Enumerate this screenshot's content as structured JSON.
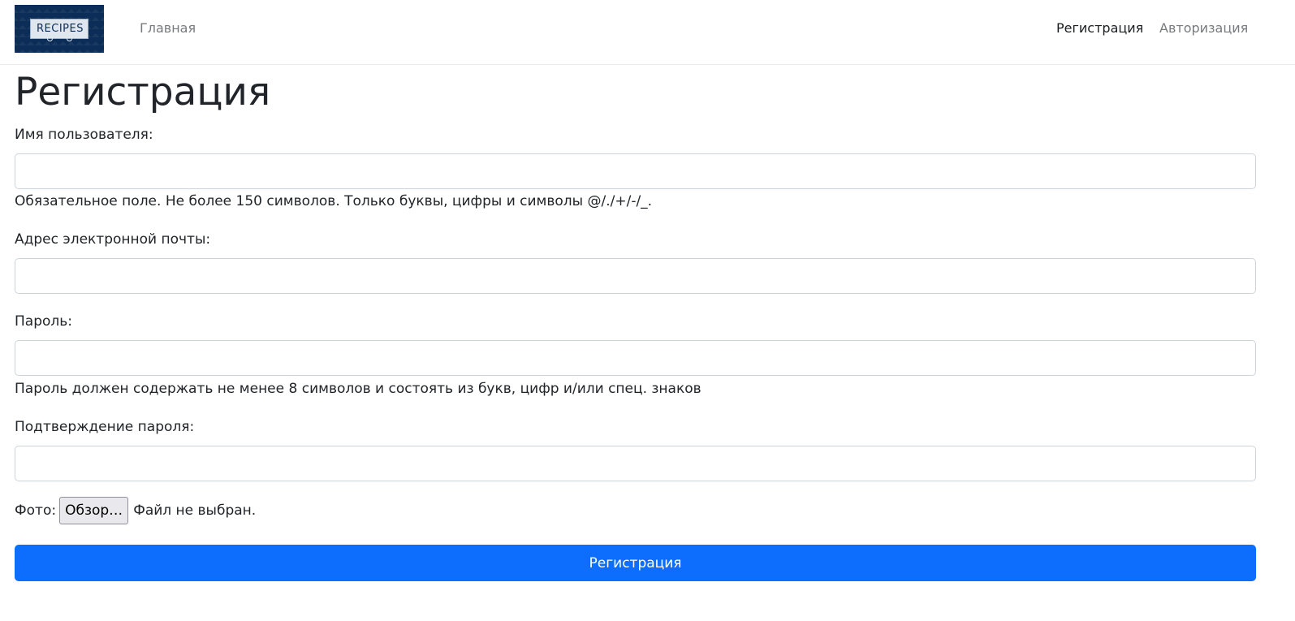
{
  "navbar": {
    "logo_text": "RECIPES",
    "home_link": "Главная",
    "register_link": "Регистрация",
    "login_link": "Авторизация"
  },
  "page": {
    "title": "Регистрация"
  },
  "form": {
    "username": {
      "label": "Имя пользователя:",
      "value": "",
      "help": "Обязательное поле. Не более 150 символов. Только буквы, цифры и символы @/./+/-/_."
    },
    "email": {
      "label": "Адрес электронной почты:",
      "value": ""
    },
    "password": {
      "label": "Пароль:",
      "value": "",
      "help": "Пароль должен содержать не менее 8 символов и состоять из букв, цифр и/или спец. знаков"
    },
    "password_confirm": {
      "label": "Подтверждение пароля:",
      "value": ""
    },
    "photo": {
      "label": "Фото:",
      "browse_label": "Обзор…",
      "status": "Файл не выбран."
    },
    "submit_label": "Регистрация"
  },
  "colors": {
    "primary": "#0d6efd",
    "logo_bg": "#0b2d57",
    "active_nav": "#1a1d20",
    "muted_nav": "#777a7e"
  }
}
